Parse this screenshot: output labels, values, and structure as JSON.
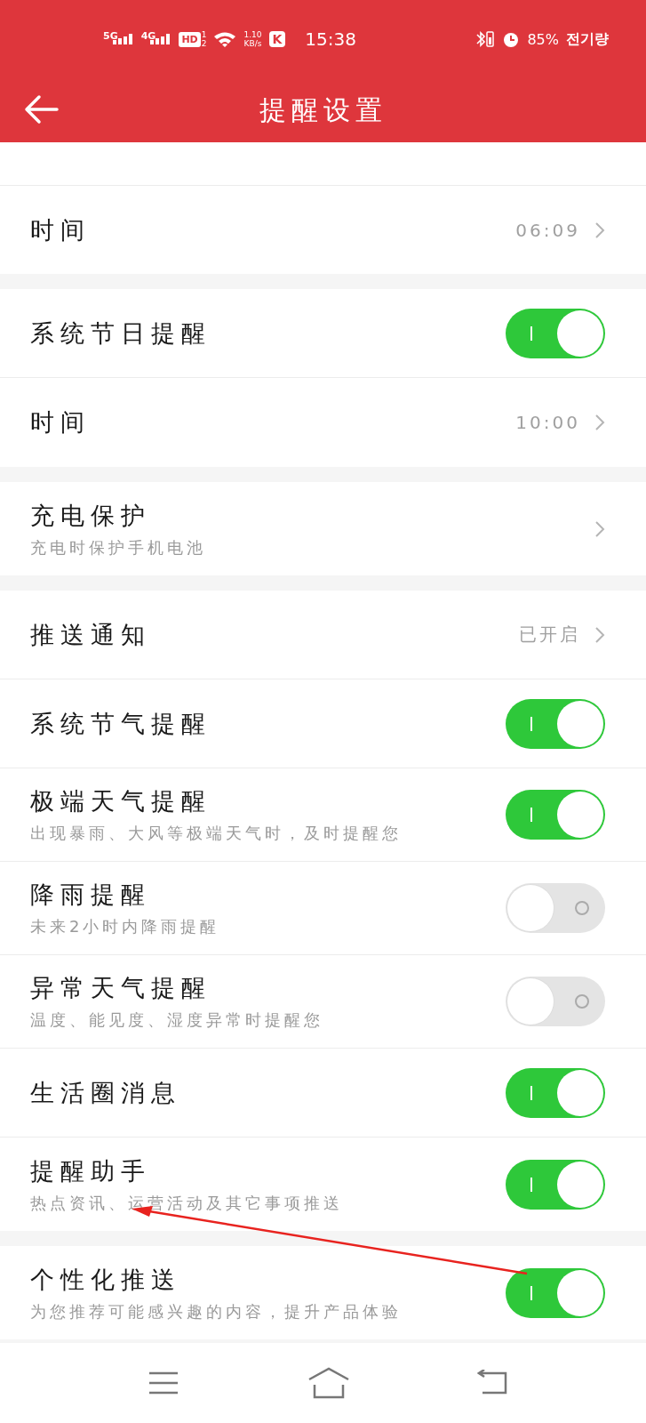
{
  "status_bar": {
    "network_1": "5G",
    "network_2": "4G",
    "hd": "HD",
    "hd_sub_1": "1",
    "hd_sub_2": "2",
    "speed": "1.10",
    "speed_unit": "KB/s",
    "app_badge": "K",
    "time": "15:38",
    "battery": "85%",
    "battery_label": "전기량"
  },
  "header": {
    "title": "提醒设置"
  },
  "sections": [
    {
      "rows": [
        {
          "kind": "link",
          "title": "时间",
          "value": "06:09"
        }
      ]
    },
    {
      "rows": [
        {
          "kind": "toggle",
          "title": "系统节日提醒",
          "on": true
        },
        {
          "kind": "link",
          "title": "时间",
          "value": "10:00"
        }
      ]
    },
    {
      "rows": [
        {
          "kind": "link",
          "title": "充电保护",
          "subtitle": "充电时保护手机电池"
        }
      ]
    },
    {
      "rows": [
        {
          "kind": "link",
          "title": "推送通知",
          "value": "已开启"
        },
        {
          "kind": "toggle",
          "title": "系统节气提醒",
          "on": true
        },
        {
          "kind": "toggle",
          "title": "极端天气提醒",
          "subtitle": "出现暴雨、大风等极端天气时，及时提醒您",
          "on": true
        },
        {
          "kind": "toggle",
          "title": "降雨提醒",
          "subtitle": "未来2小时内降雨提醒",
          "on": false
        },
        {
          "kind": "toggle",
          "title": "异常天气提醒",
          "subtitle": "温度、能见度、湿度异常时提醒您",
          "on": false
        },
        {
          "kind": "toggle",
          "title": "生活圈消息",
          "on": true
        },
        {
          "kind": "toggle",
          "title": "提醒助手",
          "subtitle": "热点资讯、运营活动及其它事项推送",
          "on": true
        }
      ]
    },
    {
      "rows": [
        {
          "kind": "toggle",
          "title": "个性化推送",
          "subtitle": "为您推荐可能感兴趣的内容，提升产品体验",
          "on": true
        }
      ]
    }
  ]
}
